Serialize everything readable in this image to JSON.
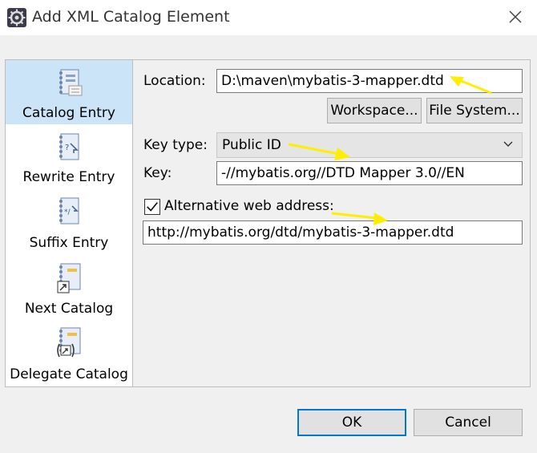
{
  "window": {
    "title": "Add XML Catalog Element"
  },
  "sidebar": {
    "items": [
      {
        "label": "Catalog Entry",
        "selected": true
      },
      {
        "label": "Rewrite Entry",
        "selected": false
      },
      {
        "label": "Suffix Entry",
        "selected": false
      },
      {
        "label": "Next Catalog",
        "selected": false
      },
      {
        "label": "Delegate Catalog",
        "selected": false
      }
    ]
  },
  "form": {
    "location_label": "Location:",
    "location_value": "D:\\maven\\mybatis-3-mapper.dtd",
    "workspace_button": "Workspace...",
    "filesystem_button": "File System...",
    "keytype_label": "Key type:",
    "keytype_value": "Public ID",
    "key_label": "Key:",
    "key_value": "-//mybatis.org//DTD Mapper 3.0//EN",
    "alt_checkbox_label": "Alternative web address:",
    "alt_checked": true,
    "alt_value": "http://mybatis.org/dtd/mybatis-3-mapper.dtd"
  },
  "footer": {
    "ok_label": "OK",
    "cancel_label": "Cancel"
  },
  "colors": {
    "selection": "#cce4f7",
    "accent": "#0078d7",
    "annotation_arrow": "#ffee00"
  }
}
